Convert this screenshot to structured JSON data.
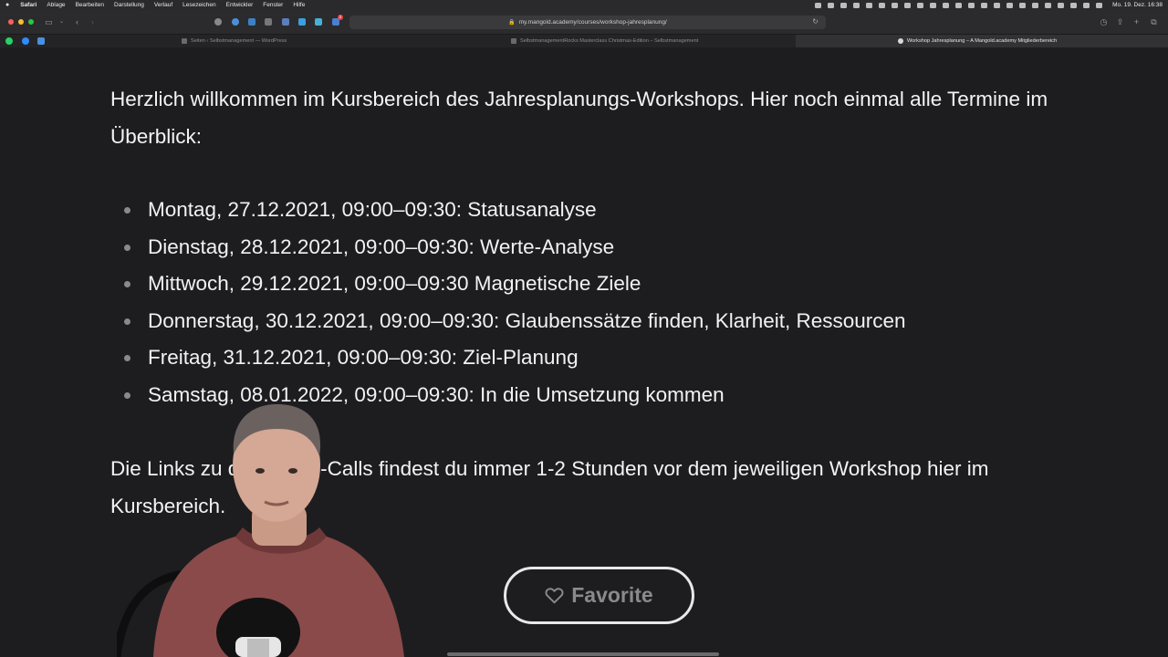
{
  "menubar": {
    "items": [
      "Safari",
      "Ablage",
      "Bearbeiten",
      "Darstellung",
      "Verlauf",
      "Lesezeichen",
      "Entwickler",
      "Fenster",
      "Hilfe"
    ],
    "clock": "Mo. 19. Dez.  16:38"
  },
  "toolbar": {
    "url": "my.mangold.academy/courses/workshop-jahresplanung/",
    "extension_badge": "2"
  },
  "tabs": [
    {
      "label": "Seiten ‹ Selbstmanagement — WordPress"
    },
    {
      "label": "SelbstmanagementRocks Masterclass Christmas-Edition – Selbstmanagement"
    },
    {
      "label": "Workshop Jahresplanung – A Mangold.academy Mitgliederbereich"
    }
  ],
  "content": {
    "intro": "Herzlich willkommen im Kursbereich des Jahresplanungs-Workshops. Hier noch einmal alle Termine im Überblick:",
    "events": [
      "Montag, 27.12.2021, 09:00–09:30: Statusanalyse",
      "Dienstag, 28.12.2021, 09:00–09:30: Werte-Analyse",
      "Mittwoch, 29.12.2021, 09:00–09:30 Magnetische Ziele",
      "Donnerstag, 30.12.2021, 09:00–09:30: Glaubenssätze finden, Klarheit, Ressourcen",
      "Freitag, 31.12.2021, 09:00–09:30: Ziel-Planung",
      "Samstag, 08.01.2022, 09:00–09:30: In die Umsetzung kommen"
    ],
    "outro": "Die Links zu den Zoom-Calls findest du immer 1-2 Stunden vor dem jeweiligen Workshop hier im Kursbereich.",
    "favorite_label": "Favorite"
  },
  "icons": {
    "favorite": "heart-outline-icon"
  }
}
